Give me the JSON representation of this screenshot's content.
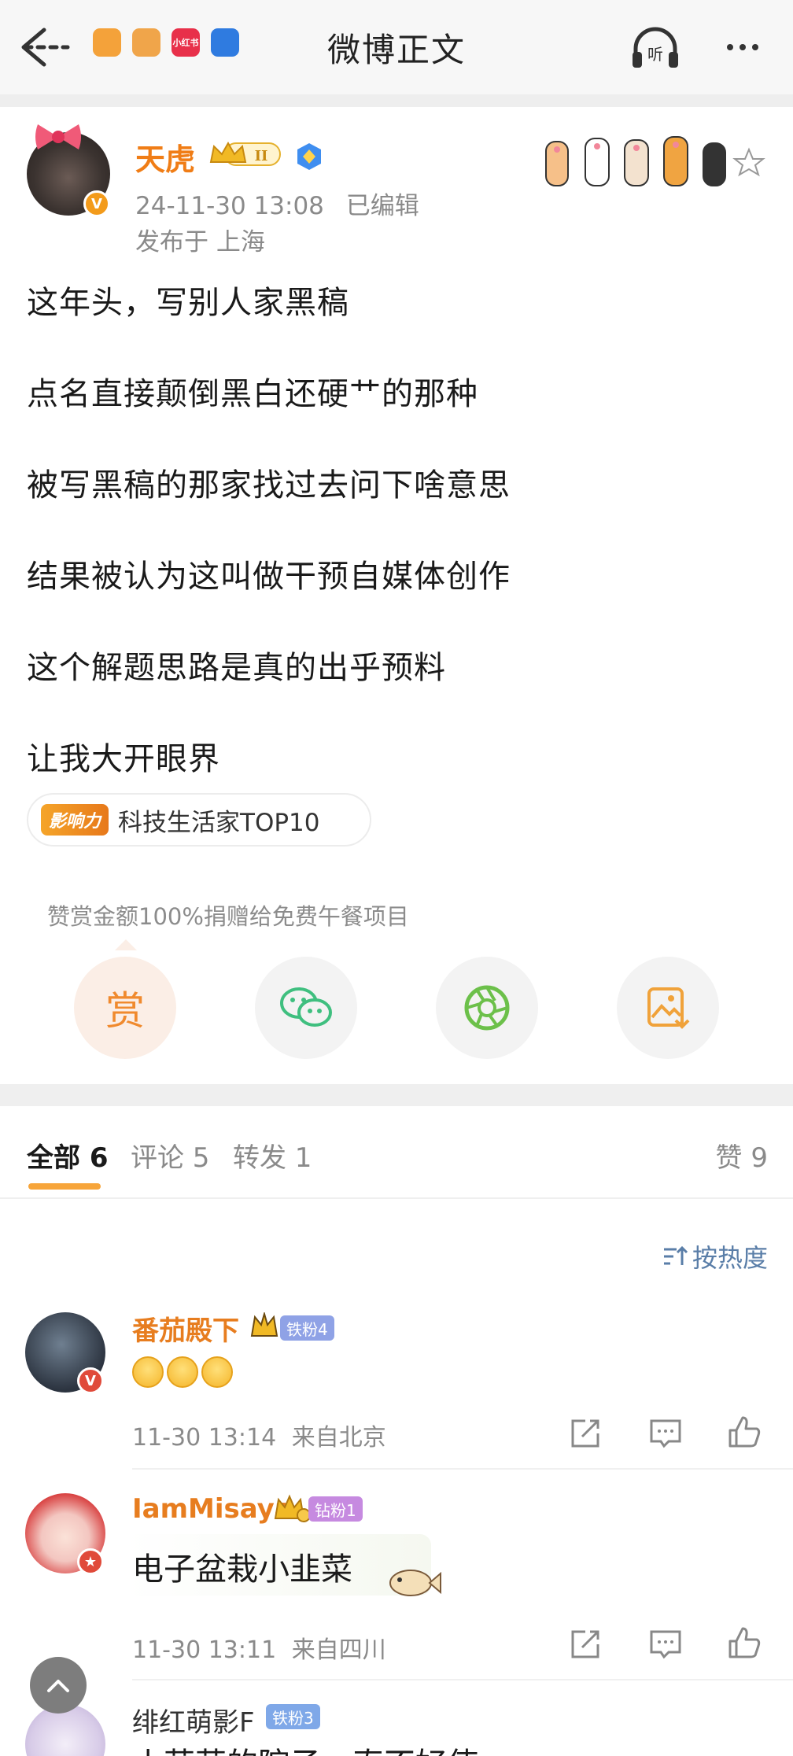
{
  "nav": {
    "title": "微博正文",
    "mini_apps": [
      "",
      "",
      "小红书",
      ""
    ],
    "listen_label": "听"
  },
  "post": {
    "author": "天虎",
    "crown_level": "II",
    "timestamp": "24-11-30 13:08",
    "edited_label": "已编辑",
    "location": "发布于 上海",
    "lines": [
      "这年头，写别人家黑稿",
      "点名直接颠倒黑白还硬艹的那种",
      "被写黑稿的那家找过去问下啥意思",
      "结果被认为这叫做干预自媒体创作",
      "这个解题思路是真的出乎预料",
      "让我大开眼界"
    ],
    "influence_badge": "影响力",
    "influence_text": "科技生活家TOP10",
    "donate_note": "赞赏金额100%捐赠给免费午餐项目",
    "reward_label": "赏"
  },
  "tabs": {
    "all": "全部 6",
    "comments": "评论 5",
    "reposts": "转发 1",
    "likes": "赞 9",
    "sort_label": "按热度"
  },
  "comments": [
    {
      "name": "番茄殿下",
      "fan_badge": "铁粉4",
      "text": "",
      "time": "11-30 13:14",
      "from": "来自北京"
    },
    {
      "name": "IamMisaya",
      "fan_badge": "钻粉1",
      "text": "电子盆栽小韭菜",
      "time": "11-30 13:11",
      "from": "来自四川"
    },
    {
      "name": "绯红萌影F",
      "fan_badge": "铁粉3",
      "text": "小蒜蒜的院子一直不好使"
    }
  ],
  "colors": {
    "accent_orange": "#f07d16",
    "link_blue": "#5a7ea8",
    "wechat_green": "#3fbf7f"
  }
}
